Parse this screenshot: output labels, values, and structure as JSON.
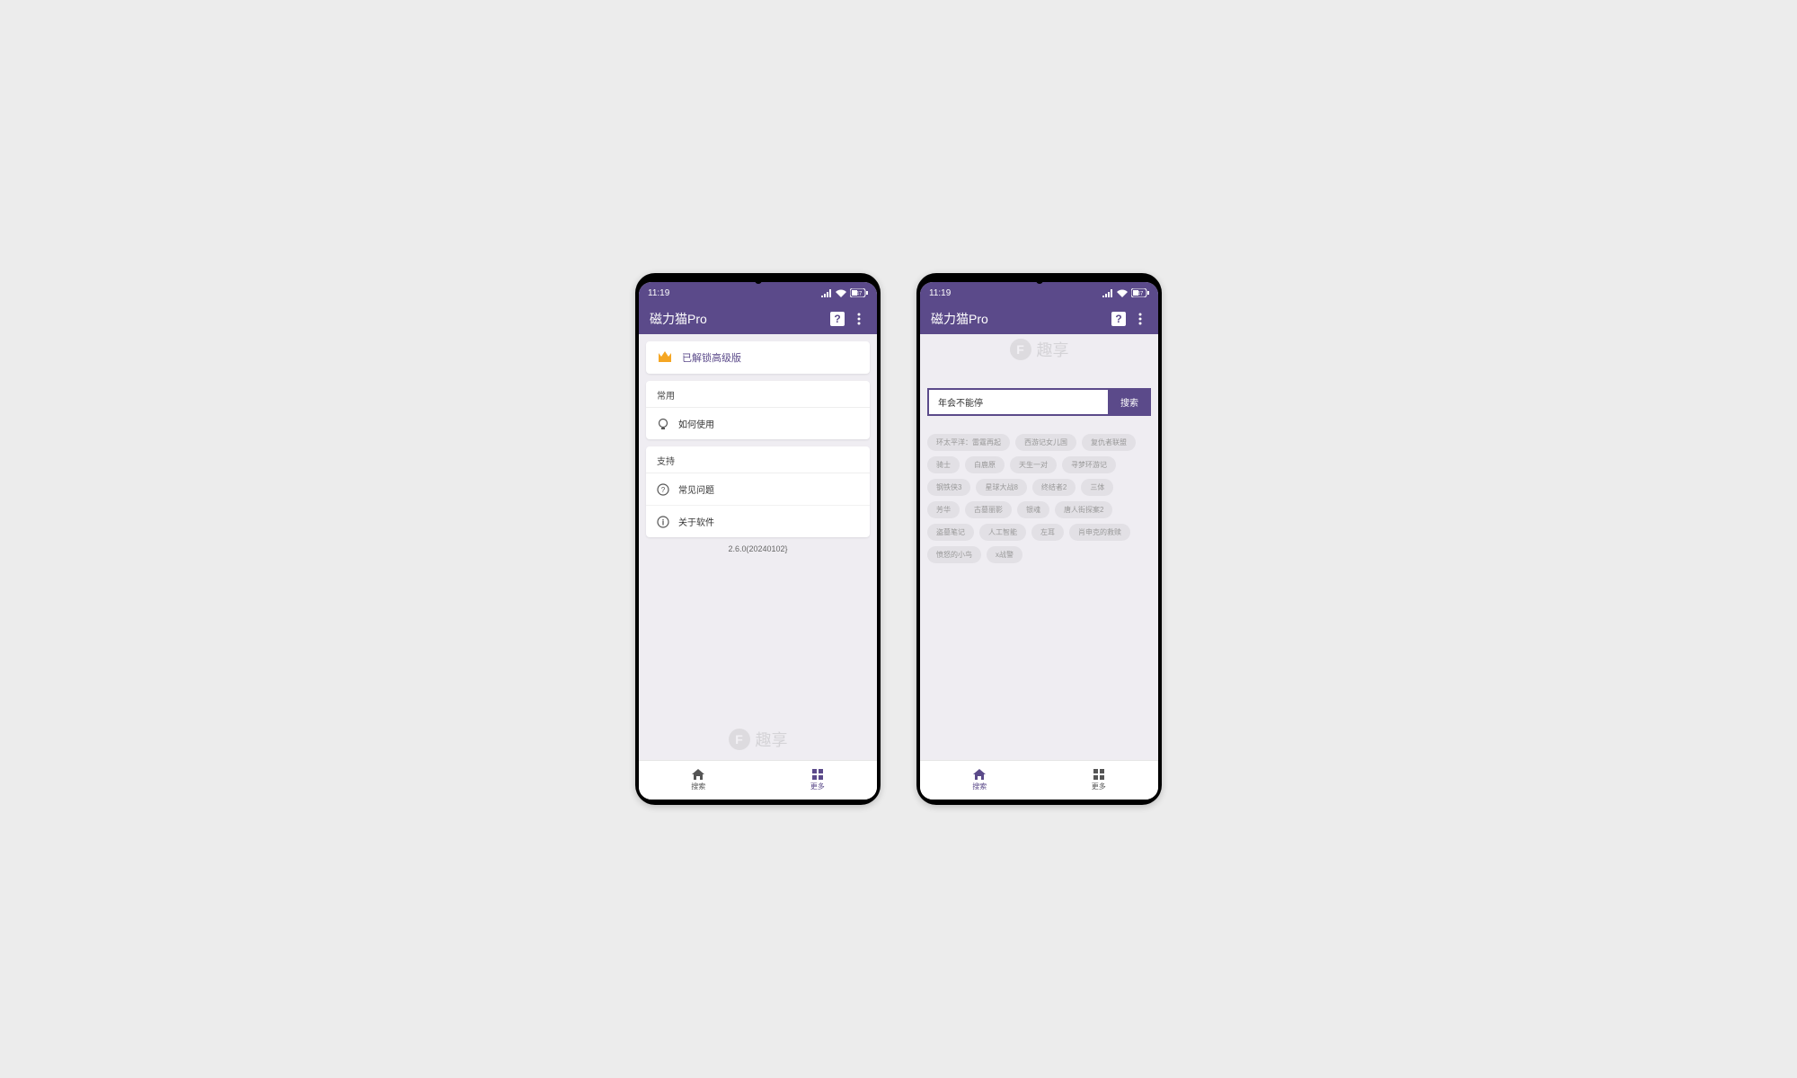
{
  "statusbar": {
    "time": "11:19",
    "battery": "47"
  },
  "app": {
    "title": "磁力猫Pro"
  },
  "premium": {
    "label": "已解锁高级版"
  },
  "sections": {
    "common": {
      "header": "常用",
      "howto": "如何使用"
    },
    "support": {
      "header": "支持",
      "faq": "常见问题",
      "about": "关于软件"
    }
  },
  "version": "2.6.0(20240102}",
  "watermark": {
    "letter": "F",
    "text": "趣享"
  },
  "nav": {
    "search": "搜索",
    "more": "更多"
  },
  "search": {
    "value": "年会不能停",
    "button": "搜索"
  },
  "tags": [
    "环太平洋：雷霆再起",
    "西游记女儿国",
    "复仇者联盟",
    "骑士",
    "白鹿原",
    "天生一对",
    "寻梦环游记",
    "钢铁侠3",
    "星球大战8",
    "终结者2",
    "三体",
    "芳华",
    "古墓丽影",
    "银魂",
    "唐人街探案2",
    "盗墓笔记",
    "人工智能",
    "左耳",
    "肖申克的救赎",
    "愤怒的小鸟",
    "x战警"
  ]
}
